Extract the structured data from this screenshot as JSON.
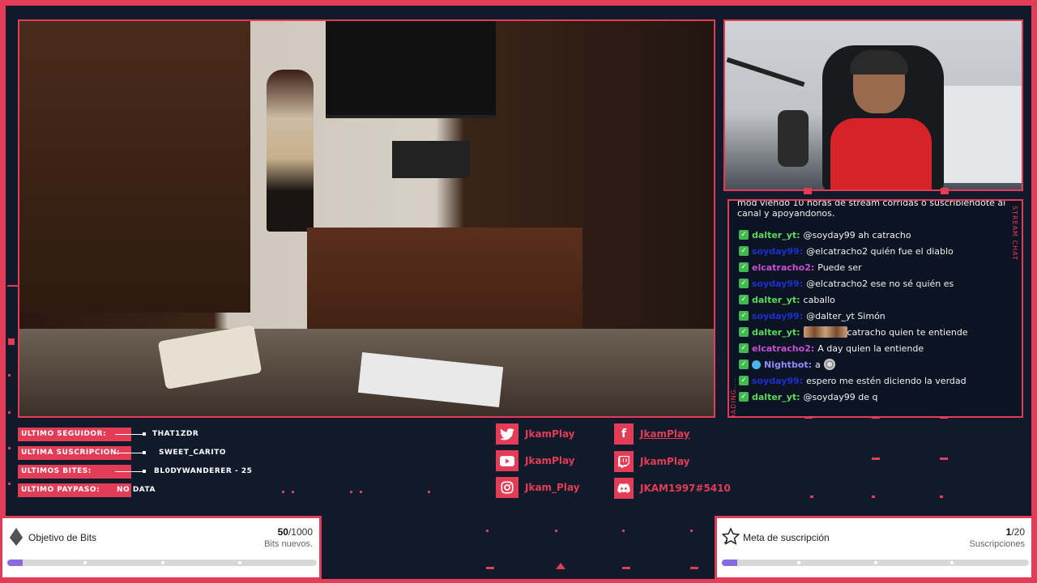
{
  "chat": {
    "intro": "mod viendo 10 horas de stream corridas o suscribiendote al canal y apoyandonos.",
    "side_label": "STREAM CHAT",
    "loading_label": "LOADING....",
    "messages": [
      {
        "user": "dalter_yt:",
        "color": "#5ad85a",
        "text": "@soyday99 ah catracho",
        "badge": "check"
      },
      {
        "user": "soyday99:",
        "color": "#1c2fd0",
        "text": "@elcatracho2 quién fue el diablo",
        "badge": "check"
      },
      {
        "user": "elcatracho2:",
        "color": "#c64fd6",
        "text": "Puede ser",
        "badge": "check"
      },
      {
        "user": "soyday99:",
        "color": "#1c2fd0",
        "text": "@elcatracho2 ese no sé quién es",
        "badge": "check"
      },
      {
        "user": "dalter_yt:",
        "color": "#5ad85a",
        "text": "caballo",
        "badge": "check"
      },
      {
        "user": "soyday99:",
        "color": "#1c2fd0",
        "text": "@dalter_yt Simón",
        "badge": "check"
      },
      {
        "user": "dalter_yt:",
        "color": "#5ad85a",
        "text": "catracho quien te entiende",
        "badge": "check",
        "emote": "wide"
      },
      {
        "user": "elcatracho2:",
        "color": "#c64fd6",
        "text": "A day quien la entiende",
        "badge": "check"
      },
      {
        "user": "Nightbot:",
        "color": "#8c8cff",
        "text": "a",
        "badge": "bot",
        "emote": "small"
      },
      {
        "user": "soyday99:",
        "color": "#1c2fd0",
        "text": "espero me estén diciendo la verdad",
        "badge": "check"
      },
      {
        "user": "dalter_yt:",
        "color": "#5ad85a",
        "text": "@soyday99 de q",
        "badge": "check"
      }
    ]
  },
  "info": {
    "follower_label": "ULTIMO SEGUIDOR:",
    "follower_value": "THAT1ZDR",
    "sub_label": "ULTIMA SUSCRIPCION:",
    "sub_value": "SWEET_CARITO",
    "bits_label": "ULTIMOS BITES:",
    "bits_value": "BL0DYWANDERER - 25",
    "paypaso_label": "ULTIMO PAYPASO:",
    "paypaso_value": "NO DATA"
  },
  "socials": {
    "twitter": "JkamPlay",
    "facebook": "JkamPlay",
    "youtube": "JkamPlay",
    "twitch": "JkamPlay",
    "instagram": "Jkam_Play",
    "discord": "JKAM1997#5410"
  },
  "goals": {
    "bits": {
      "title": "Objetivo de Bits",
      "current": "50",
      "total": "/1000",
      "subtitle": "Bits nuevos.",
      "progress": 0.05
    },
    "subs": {
      "title": "Meta de suscripción",
      "current": "1",
      "total": "/20",
      "subtitle": "Suscripciones",
      "progress": 0.05
    }
  },
  "colors": {
    "accent": "#e23c56",
    "background": "#101a2b",
    "progress_fill": "#8a6ae0"
  }
}
